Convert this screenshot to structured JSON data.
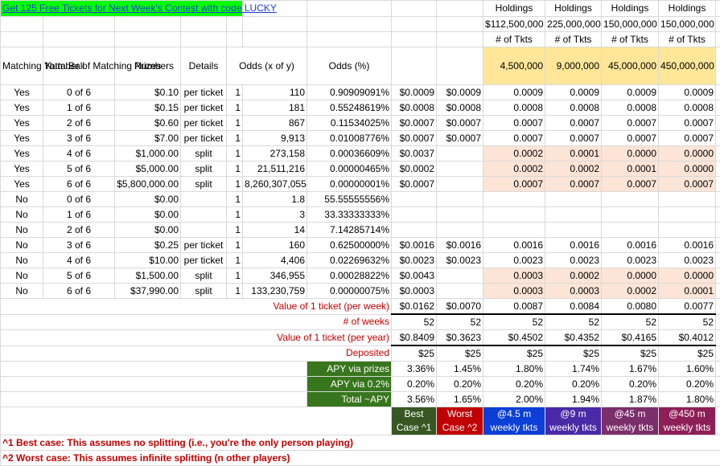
{
  "promo": "Get 125 Free Tickets for Next Week's Contest with code LUCKY",
  "holdings_label": "Holdings",
  "holdings_amounts": [
    "$112,500,000",
    "225,000,000",
    "150,000,000",
    "150,000,000"
  ],
  "num_tkts_label": "# of Tkts",
  "tickets": [
    "4,500,000",
    "9,000,000",
    "45,000,000",
    "450,000,000"
  ],
  "headers": {
    "matching_yotta_ball": "Matching Yotta Ball",
    "number_matching": "Number of Matching Numbers",
    "prizes": "Prizes",
    "details": "Details",
    "odds": "Odds (x of y)",
    "odds_pct": "Odds (%)"
  },
  "rows": [
    {
      "yb": "Yes",
      "num": "0 of 6",
      "prize": "$0.10",
      "detail": "per ticket",
      "ox": "1",
      "oy": "110",
      "pct": "0.90909091%",
      "best": "$0.0009",
      "worst": "$0.0009",
      "h": [
        "0.0009",
        "0.0009",
        "0.0009",
        "0.0009"
      ],
      "tan": false
    },
    {
      "yb": "Yes",
      "num": "1 of 6",
      "prize": "$0.15",
      "detail": "per ticket",
      "ox": "1",
      "oy": "181",
      "pct": "0.55248619%",
      "best": "$0.0008",
      "worst": "$0.0008",
      "h": [
        "0.0008",
        "0.0008",
        "0.0008",
        "0.0008"
      ],
      "tan": false
    },
    {
      "yb": "Yes",
      "num": "2 of 6",
      "prize": "$0.60",
      "detail": "per ticket",
      "ox": "1",
      "oy": "867",
      "pct": "0.11534025%",
      "best": "$0.0007",
      "worst": "$0.0007",
      "h": [
        "0.0007",
        "0.0007",
        "0.0007",
        "0.0007"
      ],
      "tan": false
    },
    {
      "yb": "Yes",
      "num": "3 of 6",
      "prize": "$7.00",
      "detail": "per ticket",
      "ox": "1",
      "oy": "9,913",
      "pct": "0.01008776%",
      "best": "$0.0007",
      "worst": "$0.0007",
      "h": [
        "0.0007",
        "0.0007",
        "0.0007",
        "0.0007"
      ],
      "tan": false
    },
    {
      "yb": "Yes",
      "num": "4 of 6",
      "prize": "$1,000.00",
      "detail": "split",
      "ox": "1",
      "oy": "273,158",
      "pct": "0.00036609%",
      "best": "$0.0037",
      "worst": "",
      "h": [
        "0.0002",
        "0.0001",
        "0.0000",
        "0.0000"
      ],
      "tan": true
    },
    {
      "yb": "Yes",
      "num": "5 of 6",
      "prize": "$5,000.00",
      "detail": "split",
      "ox": "1",
      "oy": "21,511,216",
      "pct": "0.00000465%",
      "best": "$0.0002",
      "worst": "",
      "h": [
        "0.0002",
        "0.0002",
        "0.0001",
        "0.0000"
      ],
      "tan": true
    },
    {
      "yb": "Yes",
      "num": "6 of 6",
      "prize": "$5,800,000.00",
      "detail": "split",
      "ox": "1",
      "oy": "8,260,307,055",
      "pct": "0.00000001%",
      "best": "$0.0007",
      "worst": "",
      "h": [
        "0.0007",
        "0.0007",
        "0.0007",
        "0.0007"
      ],
      "tan": true
    },
    {
      "yb": "No",
      "num": "0 of 6",
      "prize": "$0.00",
      "detail": "",
      "ox": "1",
      "oy": "1.8",
      "pct": "55.55555556%",
      "best": "",
      "worst": "",
      "h": [
        "",
        "",
        "",
        ""
      ],
      "tan": false
    },
    {
      "yb": "No",
      "num": "1 of 6",
      "prize": "$0.00",
      "detail": "",
      "ox": "1",
      "oy": "3",
      "pct": "33.33333333%",
      "best": "",
      "worst": "",
      "h": [
        "",
        "",
        "",
        ""
      ],
      "tan": false
    },
    {
      "yb": "No",
      "num": "2 of 6",
      "prize": "$0.00",
      "detail": "",
      "ox": "1",
      "oy": "14",
      "pct": "7.14285714%",
      "best": "",
      "worst": "",
      "h": [
        "",
        "",
        "",
        ""
      ],
      "tan": false
    },
    {
      "yb": "No",
      "num": "3 of 6",
      "prize": "$0.25",
      "detail": "per ticket",
      "ox": "1",
      "oy": "160",
      "pct": "0.62500000%",
      "best": "$0.0016",
      "worst": "$0.0016",
      "h": [
        "0.0016",
        "0.0016",
        "0.0016",
        "0.0016"
      ],
      "tan": false
    },
    {
      "yb": "No",
      "num": "4 of 6",
      "prize": "$10.00",
      "detail": "per ticket",
      "ox": "1",
      "oy": "4,406",
      "pct": "0.02269632%",
      "best": "$0.0023",
      "worst": "$0.0023",
      "h": [
        "0.0023",
        "0.0023",
        "0.0023",
        "0.0023"
      ],
      "tan": false
    },
    {
      "yb": "No",
      "num": "5 of 6",
      "prize": "$1,500.00",
      "detail": "split",
      "ox": "1",
      "oy": "346,955",
      "pct": "0.00028822%",
      "best": "$0.0043",
      "worst": "",
      "h": [
        "0.0003",
        "0.0002",
        "0.0000",
        "0.0000"
      ],
      "tan": true
    },
    {
      "yb": "No",
      "num": "6 of 6",
      "prize": "$37,990.00",
      "detail": "split",
      "ox": "1",
      "oy": "133,230,759",
      "pct": "0.00000075%",
      "best": "$0.0003",
      "worst": "",
      "h": [
        "0.0003",
        "0.0003",
        "0.0002",
        "0.0001"
      ],
      "tan": true
    }
  ],
  "summary": [
    {
      "label": "Value of 1 ticket (per week)",
      "best": "$0.0162",
      "worst": "$0.0070",
      "h": [
        "0.0087",
        "0.0084",
        "0.0080",
        "0.0077"
      ]
    },
    {
      "label": "# of weeks",
      "best": "52",
      "worst": "52",
      "h": [
        "52",
        "52",
        "52",
        "52"
      ]
    },
    {
      "label": "Value of 1 ticket (per year)",
      "best": "$0.8409",
      "worst": "$0.3623",
      "h": [
        "$0.4502",
        "$0.4352",
        "$0.4165",
        "$0.4012"
      ]
    },
    {
      "label": "Deposited",
      "best": "$25",
      "worst": "$25",
      "h": [
        "$25",
        "$25",
        "$25",
        "$25"
      ]
    }
  ],
  "apy": [
    {
      "label": "APY via prizes",
      "best": "3.36%",
      "worst": "1.45%",
      "h": [
        "1.80%",
        "1.74%",
        "1.67%",
        "1.60%"
      ]
    },
    {
      "label": "APY via 0.2%",
      "best": "0.20%",
      "worst": "0.20%",
      "h": [
        "0.20%",
        "0.20%",
        "0.20%",
        "0.20%"
      ]
    },
    {
      "label": "Total ~APY",
      "best": "3.56%",
      "worst": "1.65%",
      "h": [
        "2.00%",
        "1.94%",
        "1.87%",
        "1.80%"
      ]
    }
  ],
  "labels": {
    "best": [
      "Best",
      "Case ^1"
    ],
    "worst": [
      "Worst",
      "Case ^2"
    ],
    "weekly": [
      [
        "@4.5 m",
        "weekly tkts"
      ],
      [
        "@9 m",
        "weekly tkts"
      ],
      [
        "@45 m",
        "weekly tkts"
      ],
      [
        "@450 m",
        "weekly tkts"
      ]
    ]
  },
  "notes": [
    "^1 Best case: This assumes no splitting (i.e., you're the only person playing)",
    "^2 Worst case: This assumes infinite splitting (n other players)"
  ],
  "colors": {
    "header_fill": "#ffe699",
    "split_fill": "#fce4d6",
    "apy_fill": "#38761d",
    "best_fill": "#385723",
    "worst_fill": "#c00000",
    "promo_fill": "#00ff00"
  }
}
